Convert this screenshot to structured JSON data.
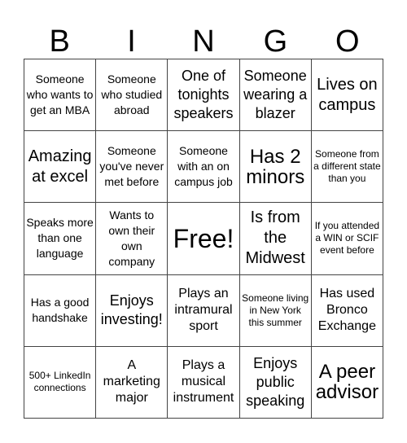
{
  "header": {
    "letters": [
      "B",
      "I",
      "N",
      "G",
      "O"
    ]
  },
  "card": {
    "rows": [
      [
        {
          "text": "Someone who wants to get an MBA",
          "size": "s"
        },
        {
          "text": "Someone who studied abroad",
          "size": "s"
        },
        {
          "text": "One of tonights speakers",
          "size": "l"
        },
        {
          "text": "Someone wearing a blazer",
          "size": "l"
        },
        {
          "text": "Lives on campus",
          "size": "xl"
        }
      ],
      [
        {
          "text": "Amazing at excel",
          "size": "xl"
        },
        {
          "text": "Someone you've never met before",
          "size": "s"
        },
        {
          "text": "Someone with an on campus job",
          "size": "s"
        },
        {
          "text": "Has 2 minors",
          "size": "xxl"
        },
        {
          "text": "Someone from a different state than you",
          "size": "xs"
        }
      ],
      [
        {
          "text": "Speaks more than one language",
          "size": "s"
        },
        {
          "text": "Wants to own their own company",
          "size": "s"
        },
        {
          "text": "Free!",
          "size": "free"
        },
        {
          "text": "Is from the Midwest",
          "size": "xl"
        },
        {
          "text": "If you attended a WIN or SCIF event before",
          "size": "xs"
        }
      ],
      [
        {
          "text": "Has a good handshake",
          "size": "s"
        },
        {
          "text": "Enjoys investing!",
          "size": "l"
        },
        {
          "text": "Plays an intramural sport",
          "size": "m"
        },
        {
          "text": "Someone living in New York this summer",
          "size": "xs"
        },
        {
          "text": "Has used Bronco Exchange",
          "size": "m"
        }
      ],
      [
        {
          "text": "500+ LinkedIn connections",
          "size": "xs"
        },
        {
          "text": "A marketing major",
          "size": "m"
        },
        {
          "text": "Plays a musical instrument",
          "size": "m"
        },
        {
          "text": "Enjoys public speaking",
          "size": "l"
        },
        {
          "text": "A peer advisor",
          "size": "xxl"
        }
      ]
    ]
  }
}
